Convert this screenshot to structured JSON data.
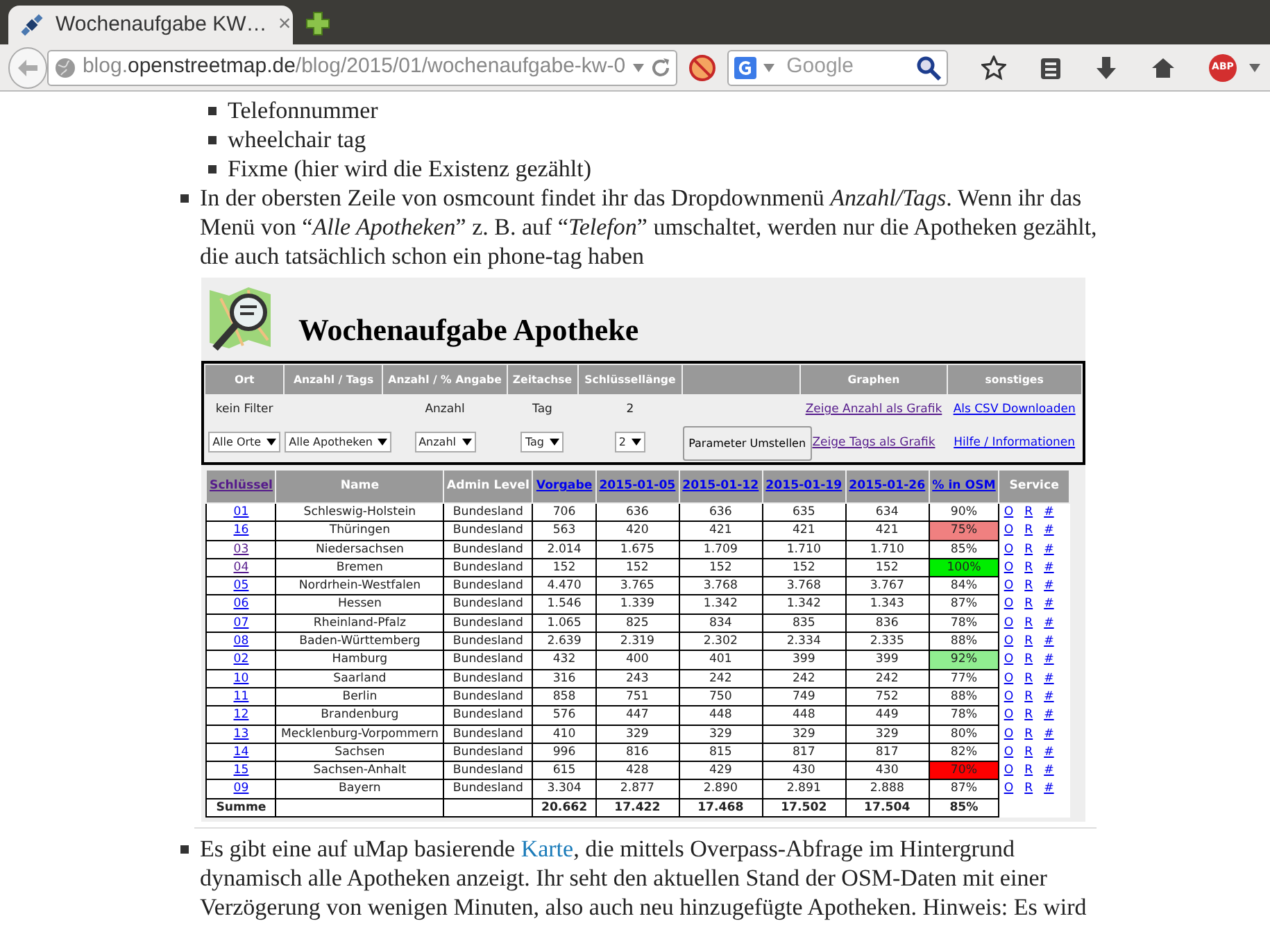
{
  "browser": {
    "tab": {
      "title": "Wochenaufgabe KW…",
      "close": "×"
    },
    "url": {
      "prefix": "blog.",
      "domain": "openstreetmap.de",
      "path": "/blog/2015/01/wochenaufgabe-kw-0"
    },
    "search": {
      "placeholder": "Google"
    },
    "abp_label": "ABP"
  },
  "article": {
    "sub_items": [
      "Telefonnummer",
      "wheelchair tag",
      "Fixme (hier wird die Existenz gezählt)"
    ],
    "paragraph_1": "In der obersten Zeile von osmcount findet ihr das Dropdownmenü *Anzahl/Tags*.  Wenn ihr das Menü von “*Alle Apotheken*” z. B. auf “*Telefon*” umschaltet, werden nur die Apotheken gezählt, die auch tatsächlich schon ein phone-tag haben",
    "paragraph_2": {
      "before": "Es gibt eine auf uMap basierende ",
      "link": "Karte",
      "after": ", die mittels Overpass-Abfrage im Hintergrund dynamisch alle Apotheken anzeigt.  Ihr seht den aktuellen Stand der OSM-Daten mit einer Verzögerung von wenigen Minuten, also auch neu hinzugefügte Apotheken. Hinweis: Es wird"
    }
  },
  "embedded": {
    "title": "Wochenaufgabe Apotheke",
    "controls": [
      {
        "header": "Ort",
        "current": "kein Filter",
        "select": "Alle Orte"
      },
      {
        "header": "Anzahl / Tags",
        "select": "Alle Apotheken"
      },
      {
        "header": "Anzahl / % Angabe",
        "current": "Anzahl",
        "select": "Anzahl"
      },
      {
        "header": "Zeitachse",
        "current": "Tag",
        "select": "Tag"
      },
      {
        "header": "Schlüssellänge",
        "current": "2",
        "select": "2"
      },
      {
        "button": "Parameter Umstellen"
      },
      {
        "header": "Graphen",
        "links": [
          {
            "text": "Zeige Anzahl als Grafik",
            "visited": true
          },
          {
            "text": "Zeige Tags als Grafik",
            "visited": true
          }
        ]
      },
      {
        "header": "sonstiges",
        "links": [
          {
            "text": "Als CSV Downloaden",
            "visited": false
          },
          {
            "text": "Hilfe / Informationen",
            "visited": false
          }
        ]
      }
    ],
    "table": {
      "columns": [
        {
          "label": "Schlüssel",
          "kind": "link",
          "visited": true
        },
        {
          "label": "Name",
          "kind": "text"
        },
        {
          "label": "Admin Level",
          "kind": "text"
        },
        {
          "label": "Vorgabe",
          "kind": "link",
          "visited": false
        },
        {
          "label": "2015-01-05",
          "kind": "link",
          "visited": false
        },
        {
          "label": "2015-01-12",
          "kind": "link",
          "visited": false
        },
        {
          "label": "2015-01-19",
          "kind": "link",
          "visited": false
        },
        {
          "label": "2015-01-26",
          "kind": "link",
          "visited": false
        },
        {
          "label": "% in OSM",
          "kind": "link",
          "visited": false
        },
        {
          "label": "Service",
          "kind": "text"
        }
      ],
      "rows": [
        {
          "key": "01",
          "visited": false,
          "name": "Schleswig-Holstein",
          "level": "Bundesland",
          "values": [
            "706",
            "636",
            "636",
            "635",
            "634"
          ],
          "pct": "90%",
          "service": [
            "O",
            "R",
            "#"
          ]
        },
        {
          "key": "16",
          "visited": false,
          "name": "Thüringen",
          "level": "Bundesland",
          "values": [
            "563",
            "420",
            "421",
            "421",
            "421"
          ],
          "pct": "75%",
          "color": "#f08080",
          "service": [
            "O",
            "R",
            "#"
          ]
        },
        {
          "key": "03",
          "visited": true,
          "name": "Niedersachsen",
          "level": "Bundesland",
          "values": [
            "2.014",
            "1.675",
            "1.709",
            "1.710",
            "1.710"
          ],
          "pct": "85%",
          "service": [
            "O",
            "R",
            "#"
          ]
        },
        {
          "key": "04",
          "visited": true,
          "name": "Bremen",
          "level": "Bundesland",
          "values": [
            "152",
            "152",
            "152",
            "152",
            "152"
          ],
          "pct": "100%",
          "color": "#00ee00",
          "service": [
            "O",
            "R",
            "#"
          ]
        },
        {
          "key": "05",
          "visited": false,
          "name": "Nordrhein-Westfalen",
          "level": "Bundesland",
          "values": [
            "4.470",
            "3.765",
            "3.768",
            "3.768",
            "3.767"
          ],
          "pct": "84%",
          "service": [
            "O",
            "R",
            "#"
          ]
        },
        {
          "key": "06",
          "visited": false,
          "name": "Hessen",
          "level": "Bundesland",
          "values": [
            "1.546",
            "1.339",
            "1.342",
            "1.342",
            "1.343"
          ],
          "pct": "87%",
          "service": [
            "O",
            "R",
            "#"
          ]
        },
        {
          "key": "07",
          "visited": false,
          "name": "Rheinland-Pfalz",
          "level": "Bundesland",
          "values": [
            "1.065",
            "825",
            "834",
            "835",
            "836"
          ],
          "pct": "78%",
          "service": [
            "O",
            "R",
            "#"
          ]
        },
        {
          "key": "08",
          "visited": false,
          "name": "Baden-Württemberg",
          "level": "Bundesland",
          "values": [
            "2.639",
            "2.319",
            "2.302",
            "2.334",
            "2.335"
          ],
          "pct": "88%",
          "service": [
            "O",
            "R",
            "#"
          ]
        },
        {
          "key": "02",
          "visited": false,
          "name": "Hamburg",
          "level": "Bundesland",
          "values": [
            "432",
            "400",
            "401",
            "399",
            "399"
          ],
          "pct": "92%",
          "color": "#90ee90",
          "service": [
            "O",
            "R",
            "#"
          ]
        },
        {
          "key": "10",
          "visited": false,
          "name": "Saarland",
          "level": "Bundesland",
          "values": [
            "316",
            "243",
            "242",
            "242",
            "242"
          ],
          "pct": "77%",
          "service": [
            "O",
            "R",
            "#"
          ]
        },
        {
          "key": "11",
          "visited": false,
          "name": "Berlin",
          "level": "Bundesland",
          "values": [
            "858",
            "751",
            "750",
            "749",
            "752"
          ],
          "pct": "88%",
          "service": [
            "O",
            "R",
            "#"
          ]
        },
        {
          "key": "12",
          "visited": false,
          "name": "Brandenburg",
          "level": "Bundesland",
          "values": [
            "576",
            "447",
            "448",
            "448",
            "449"
          ],
          "pct": "78%",
          "service": [
            "O",
            "R",
            "#"
          ]
        },
        {
          "key": "13",
          "visited": false,
          "name": "Mecklenburg-Vorpommern",
          "level": "Bundesland",
          "values": [
            "410",
            "329",
            "329",
            "329",
            "329"
          ],
          "pct": "80%",
          "service": [
            "O",
            "R",
            "#"
          ]
        },
        {
          "key": "14",
          "visited": false,
          "name": "Sachsen",
          "level": "Bundesland",
          "values": [
            "996",
            "816",
            "815",
            "817",
            "817"
          ],
          "pct": "82%",
          "service": [
            "O",
            "R",
            "#"
          ]
        },
        {
          "key": "15",
          "visited": false,
          "name": "Sachsen-Anhalt",
          "level": "Bundesland",
          "values": [
            "615",
            "428",
            "429",
            "430",
            "430"
          ],
          "pct": "70%",
          "color": "#ff0000",
          "service": [
            "O",
            "R",
            "#"
          ]
        },
        {
          "key": "09",
          "visited": false,
          "name": "Bayern",
          "level": "Bundesland",
          "values": [
            "3.304",
            "2.877",
            "2.890",
            "2.891",
            "2.888"
          ],
          "pct": "87%",
          "service": [
            "O",
            "R",
            "#"
          ]
        }
      ],
      "sum": {
        "label": "Summe",
        "values": [
          "20.662",
          "17.422",
          "17.468",
          "17.502",
          "17.504"
        ],
        "pct": "85%"
      }
    }
  }
}
